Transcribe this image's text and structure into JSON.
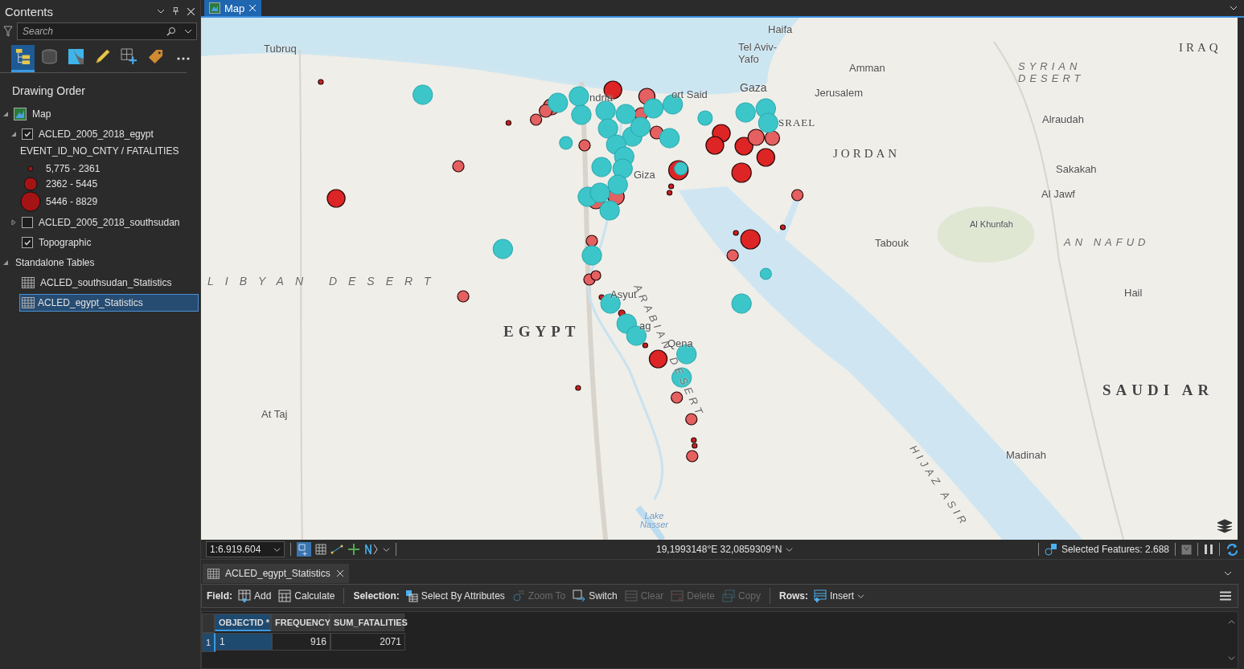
{
  "contents_pane": {
    "title": "Contents",
    "search": {
      "placeholder": "Search"
    },
    "toolbar": [
      {
        "kind": "drawing-order",
        "selected": true
      },
      {
        "kind": "data-source",
        "selected": false
      },
      {
        "kind": "selection",
        "selected": false
      },
      {
        "kind": "editing",
        "selected": false
      },
      {
        "kind": "snapping",
        "selected": false
      },
      {
        "kind": "labeling",
        "selected": false
      }
    ],
    "heading": "Drawing Order",
    "tree": [
      {
        "kind": "map",
        "label": "Map",
        "expanded": true,
        "children": [
          {
            "kind": "layer",
            "label": "ACLED_2005_2018_egypt",
            "checked": true,
            "expanded": true,
            "legend": {
              "field": "EVENT_ID_NO_CNTY / FATALITIES",
              "classes": [
                {
                  "label": "5,775 - 2361"
                },
                {
                  "label": "2362 - 5445"
                },
                {
                  "label": "5446 - 8829"
                }
              ]
            }
          },
          {
            "kind": "layer",
            "label": "ACLED_2005_2018_southsudan",
            "checked": false,
            "expanded": false
          },
          {
            "kind": "basemap",
            "label": "Topographic",
            "checked": true
          }
        ]
      },
      {
        "kind": "group",
        "label": "Standalone Tables",
        "expanded": true,
        "children": [
          {
            "kind": "table",
            "label": "ACLED_southsudan_Statistics",
            "selected": false
          },
          {
            "kind": "table",
            "label": "ACLED_egypt_Statistics",
            "selected": true
          }
        ]
      }
    ]
  },
  "map_view": {
    "tab": {
      "label": "Map",
      "selected": true
    },
    "labels": [
      "Haifa",
      "Tubruq",
      "Tel Aviv-Yafo",
      "IRAQ",
      "Amman",
      "SYRIAN DESERT",
      "ndria",
      "ort Said",
      "Gaza",
      "Jerusalem",
      "SRAEL",
      "Alraudah",
      "JORDAN",
      "Giza",
      "Sakakah",
      "Al Jawf",
      "Al Khunfah",
      "Tabouk",
      "AN NAFUD",
      "LIBYAN DESERT",
      "Asyut",
      "ARABIAN DESERT",
      "Hail",
      "EGYPT",
      "ag",
      "Qena",
      "SAUDI AR",
      "At Taj",
      "HIJAZ ASIR",
      "Madinah",
      "Lake Nasser"
    ]
  },
  "status_bar": {
    "scale": "1:6.919.604",
    "coordinates": "19,1993148°E 32,0859309°N",
    "selected_features": "Selected Features: 2.688"
  },
  "table_pane": {
    "tab": {
      "label": "ACLED_egypt_Statistics",
      "selected": true
    },
    "groups": [
      {
        "label": "Field:",
        "buttons": [
          {
            "kind": "add",
            "label": "Add",
            "disabled": false
          },
          {
            "kind": "calculate",
            "label": "Calculate",
            "disabled": false
          }
        ]
      },
      {
        "label": "Selection:",
        "buttons": [
          {
            "kind": "select-by-attributes",
            "label": "Select By Attributes",
            "disabled": false
          },
          {
            "kind": "zoom-to",
            "label": "Zoom To",
            "disabled": true
          },
          {
            "kind": "switch",
            "label": "Switch",
            "disabled": false
          },
          {
            "kind": "clear",
            "label": "Clear",
            "disabled": true
          },
          {
            "kind": "delete",
            "label": "Delete",
            "disabled": true
          },
          {
            "kind": "copy",
            "label": "Copy",
            "disabled": true
          }
        ]
      },
      {
        "label": "Rows:",
        "buttons": [
          {
            "kind": "insert",
            "label": "Insert",
            "disabled": false,
            "dropdown": true
          }
        ]
      }
    ],
    "columns": [
      {
        "label": "OBJECTID *",
        "selected": true
      },
      {
        "label": "FREQUENCY",
        "selected": false
      },
      {
        "label": "SUM_FATALITIES",
        "selected": false
      }
    ],
    "rows": [
      {
        "number": "1",
        "selected": true,
        "cells": [
          "1",
          "916",
          "2071"
        ]
      }
    ]
  }
}
